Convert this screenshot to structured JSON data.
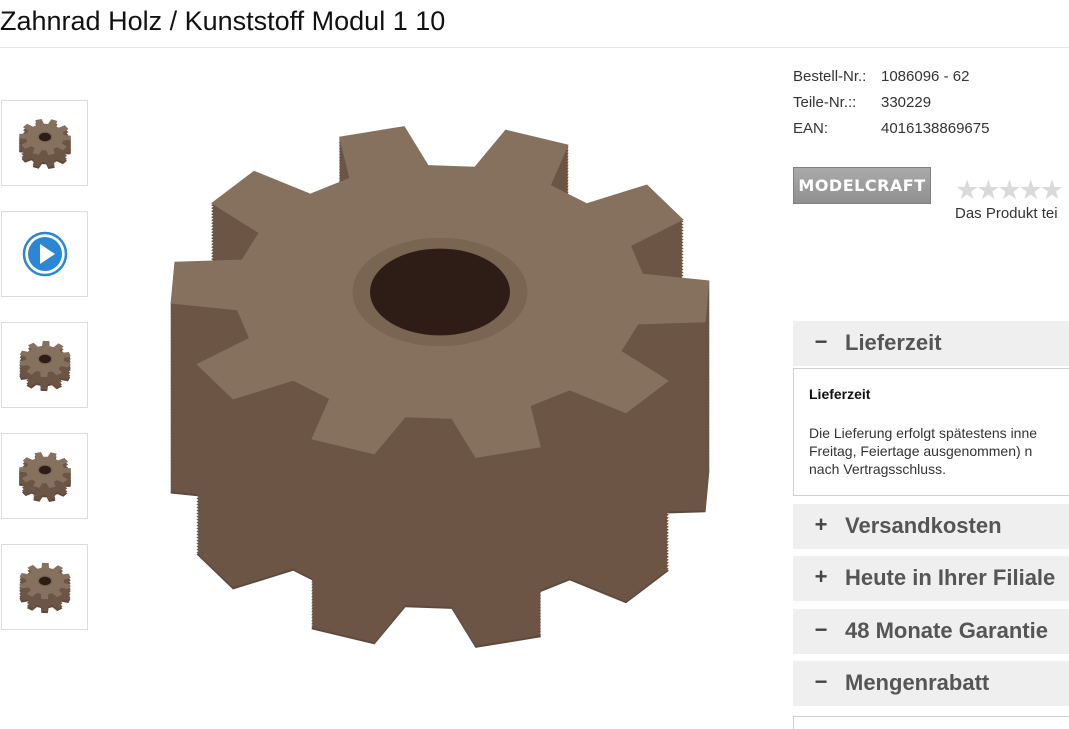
{
  "product": {
    "title": "Zahnrad Holz / Kunststoff Modul 1 10"
  },
  "thumbnails": [
    {
      "kind": "image",
      "icon": "gear-photo-icon"
    },
    {
      "kind": "video",
      "icon": "play-icon",
      "color": "#2b86d3"
    },
    {
      "kind": "image",
      "icon": "gear-photo-icon"
    },
    {
      "kind": "image",
      "icon": "gear-photo-icon"
    },
    {
      "kind": "image",
      "icon": "gear-photo-icon"
    }
  ],
  "specs": [
    {
      "label": "Bestell-Nr.:",
      "value": "1086096 - 62"
    },
    {
      "label": "Teile-Nr.::",
      "value": "330229"
    },
    {
      "label": "EAN:",
      "value": "4016138869675"
    }
  ],
  "brand": {
    "logo_text": "MODELCRAFT"
  },
  "rating": {
    "stars": 0,
    "text": "Das Produkt tei"
  },
  "accordion": [
    {
      "sign": "−",
      "label": "Lieferzeit",
      "expanded": true
    },
    {
      "sign": "+",
      "label": "Versandkosten",
      "expanded": false
    },
    {
      "sign": "+",
      "label": "Heute in Ihrer Filiale",
      "expanded": false
    },
    {
      "sign": "−",
      "label": "48 Monate Garantie",
      "expanded": true
    },
    {
      "sign": "−",
      "label": "Mengenrabatt",
      "expanded": true
    }
  ],
  "delivery_panel": {
    "title": "Lieferzeit",
    "lines": [
      "Die Lieferung erfolgt spätestens inne",
      "Freitag, Feiertage ausgenommen) n",
      "nach Vertragsschluss."
    ]
  },
  "colors": {
    "gear": "#7a6250",
    "accordion_bg": "#efefef",
    "play_button": "#2b86d3"
  }
}
